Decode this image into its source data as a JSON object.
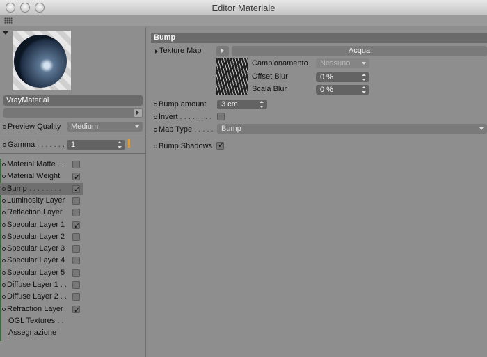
{
  "window": {
    "title": "Editor Materiale"
  },
  "left": {
    "material_name": "VrayMaterial",
    "preview_quality": {
      "label": "Preview Quality",
      "value": "Medium"
    },
    "gamma": {
      "label": "Gamma",
      "dots": ". . . . . . .",
      "value": "1"
    },
    "channels": [
      {
        "label": "Material Matte",
        "dots": ". .",
        "checked": false,
        "active": false
      },
      {
        "label": "Material Weight",
        "dots": "",
        "checked": true,
        "active": false
      },
      {
        "label": "Bump",
        "dots": ". . . . . . . .",
        "checked": true,
        "active": true
      },
      {
        "label": "Luminosity Layer",
        "dots": "",
        "checked": false,
        "active": false
      },
      {
        "label": "Reflection Layer",
        "dots": "",
        "checked": false,
        "active": false
      },
      {
        "label": "Specular Layer 1",
        "dots": "",
        "checked": true,
        "active": false
      },
      {
        "label": "Specular Layer 2",
        "dots": "",
        "checked": false,
        "active": false
      },
      {
        "label": "Specular Layer 3",
        "dots": "",
        "checked": false,
        "active": false
      },
      {
        "label": "Specular Layer 4",
        "dots": "",
        "checked": false,
        "active": false
      },
      {
        "label": "Specular Layer 5",
        "dots": "",
        "checked": false,
        "active": false
      },
      {
        "label": "Diffuse Layer 1",
        "dots": ". .",
        "checked": false,
        "active": false
      },
      {
        "label": "Diffuse Layer 2",
        "dots": ". .",
        "checked": false,
        "active": false
      },
      {
        "label": "Refraction Layer",
        "dots": "",
        "checked": true,
        "active": false
      }
    ],
    "extras": [
      {
        "label": "OGL Textures",
        "dots": ". ."
      },
      {
        "label": "Assegnazione",
        "dots": ""
      }
    ]
  },
  "right": {
    "section_title": "Bump",
    "texture_map": {
      "label": "Texture Map",
      "value": "Acqua"
    },
    "campionamento": {
      "label": "Campionamento",
      "value": "Nessuno"
    },
    "offset_blur": {
      "label": "Offset Blur",
      "value": "0 %"
    },
    "scala_blur": {
      "label": "Scala Blur",
      "value": "0 %"
    },
    "bump_amount": {
      "label": "Bump amount",
      "value": "3 cm"
    },
    "invert": {
      "label": "Invert",
      "dots": ". . . . . . . .",
      "checked": false
    },
    "map_type": {
      "label": "Map Type",
      "dots": ". . . . .",
      "value": "Bump"
    },
    "bump_shadows": {
      "label": "Bump Shadows",
      "checked": true
    }
  }
}
